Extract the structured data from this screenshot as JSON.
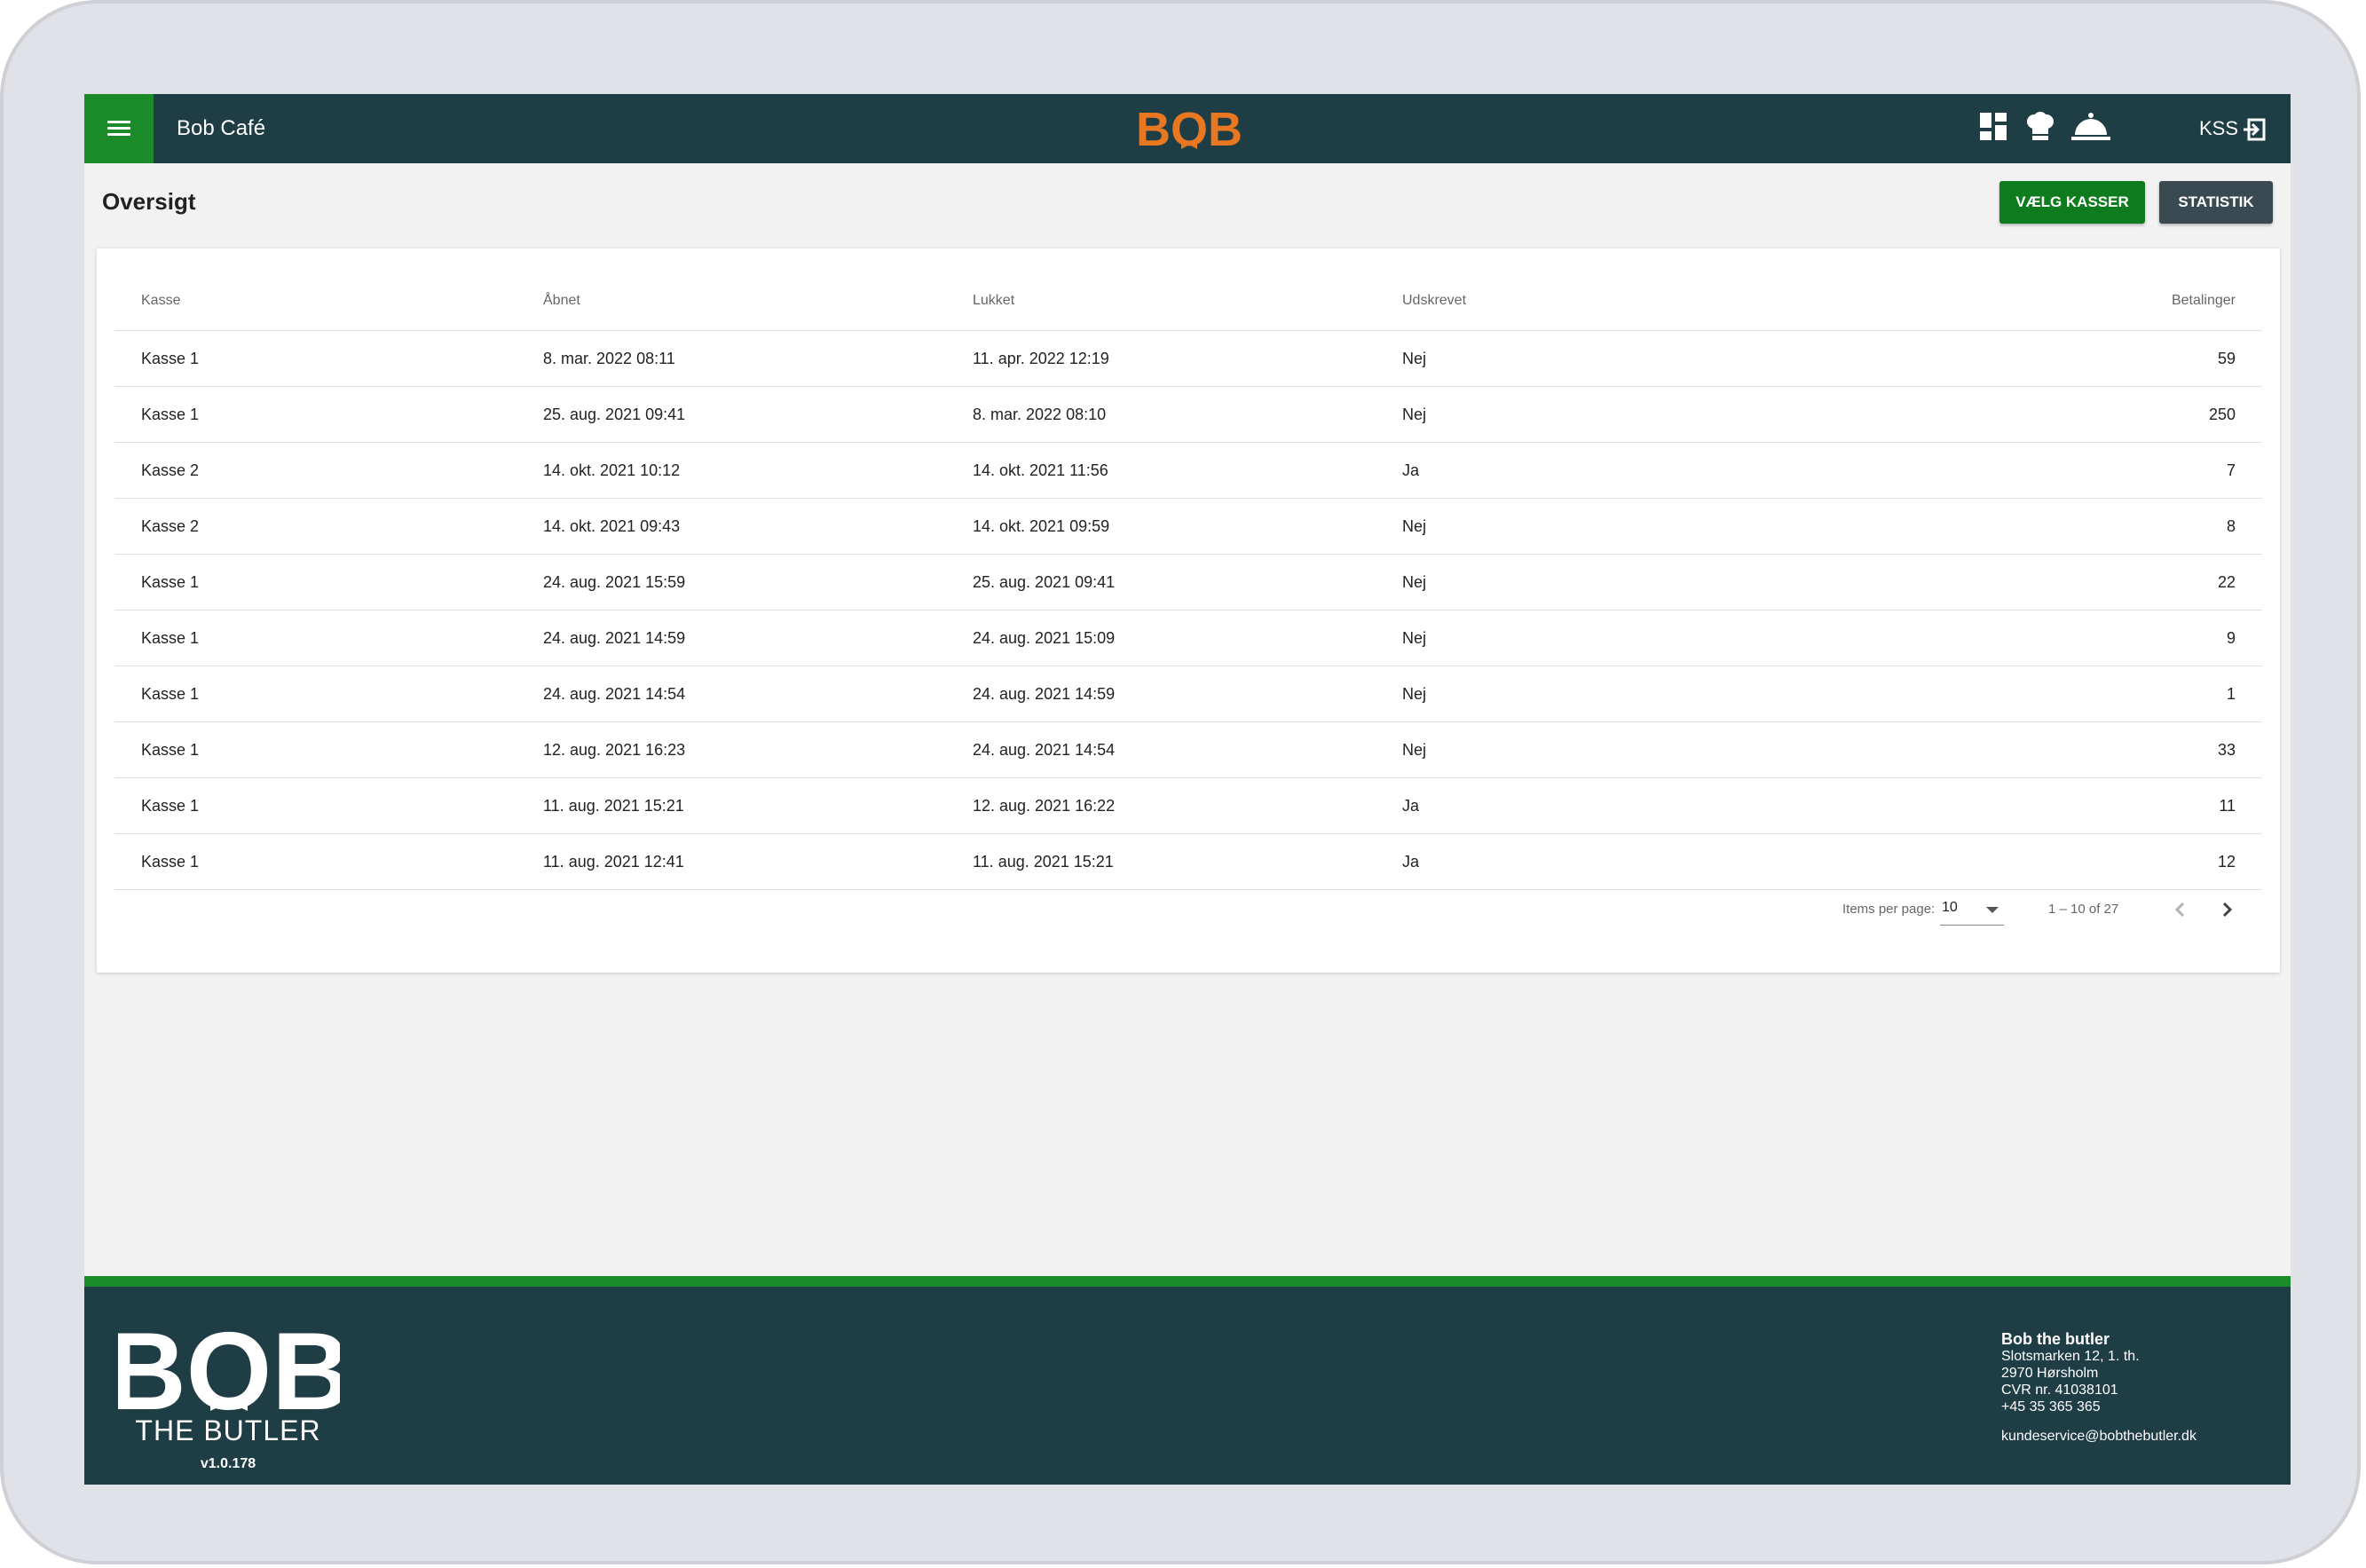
{
  "header": {
    "venue": "Bob Café",
    "logo_text": "BOB",
    "user_code": "KSS",
    "logo_color": "#e87722",
    "bar_color": "#1e3d45",
    "menu_color": "#1b8a28"
  },
  "toolbar": {
    "title": "Oversigt",
    "choose_registers": "VÆLG KASSER",
    "statistics": "STATISTIK"
  },
  "table": {
    "columns": [
      "Kasse",
      "Åbnet",
      "Lukket",
      "Udskrevet",
      "Betalinger"
    ],
    "rows": [
      [
        "Kasse 1",
        "8. mar. 2022 08:11",
        "11. apr. 2022 12:19",
        "Nej",
        "59"
      ],
      [
        "Kasse 1",
        "25. aug. 2021 09:41",
        "8. mar. 2022 08:10",
        "Nej",
        "250"
      ],
      [
        "Kasse 2",
        "14. okt. 2021 10:12",
        "14. okt. 2021 11:56",
        "Ja",
        "7"
      ],
      [
        "Kasse 2",
        "14. okt. 2021 09:43",
        "14. okt. 2021 09:59",
        "Nej",
        "8"
      ],
      [
        "Kasse 1",
        "24. aug. 2021 15:59",
        "25. aug. 2021 09:41",
        "Nej",
        "22"
      ],
      [
        "Kasse 1",
        "24. aug. 2021 14:59",
        "24. aug. 2021 15:09",
        "Nej",
        "9"
      ],
      [
        "Kasse 1",
        "24. aug. 2021 14:54",
        "24. aug. 2021 14:59",
        "Nej",
        "1"
      ],
      [
        "Kasse 1",
        "12. aug. 2021 16:23",
        "24. aug. 2021 14:54",
        "Nej",
        "33"
      ],
      [
        "Kasse 1",
        "11. aug. 2021 15:21",
        "12. aug. 2021 16:22",
        "Ja",
        "11"
      ],
      [
        "Kasse 1",
        "11. aug. 2021 12:41",
        "11. aug. 2021 15:21",
        "Ja",
        "12"
      ]
    ]
  },
  "paginator": {
    "items_per_page_label": "Items per page:",
    "page_size": "10",
    "range": "1 – 10 of 27"
  },
  "footer": {
    "logo_text": "BOB",
    "tagline": "THE BUTLER",
    "version": "v1.0.178",
    "company_name": "Bob the butler",
    "address_line1": "Slotsmarken 12, 1. th.",
    "address_line2": "2970 Hørsholm",
    "cvr": "CVR nr. 41038101",
    "phone": "+45 35 365 365",
    "email": "kundeservice@bobthebutler.dk",
    "accent_color": "#1b8a28"
  },
  "icons": [
    "menu-icon",
    "dashboard-icon",
    "chef-hat-icon",
    "cloche-icon",
    "logout-icon",
    "chevron-left-icon",
    "chevron-right-icon",
    "dropdown-caret-icon"
  ]
}
